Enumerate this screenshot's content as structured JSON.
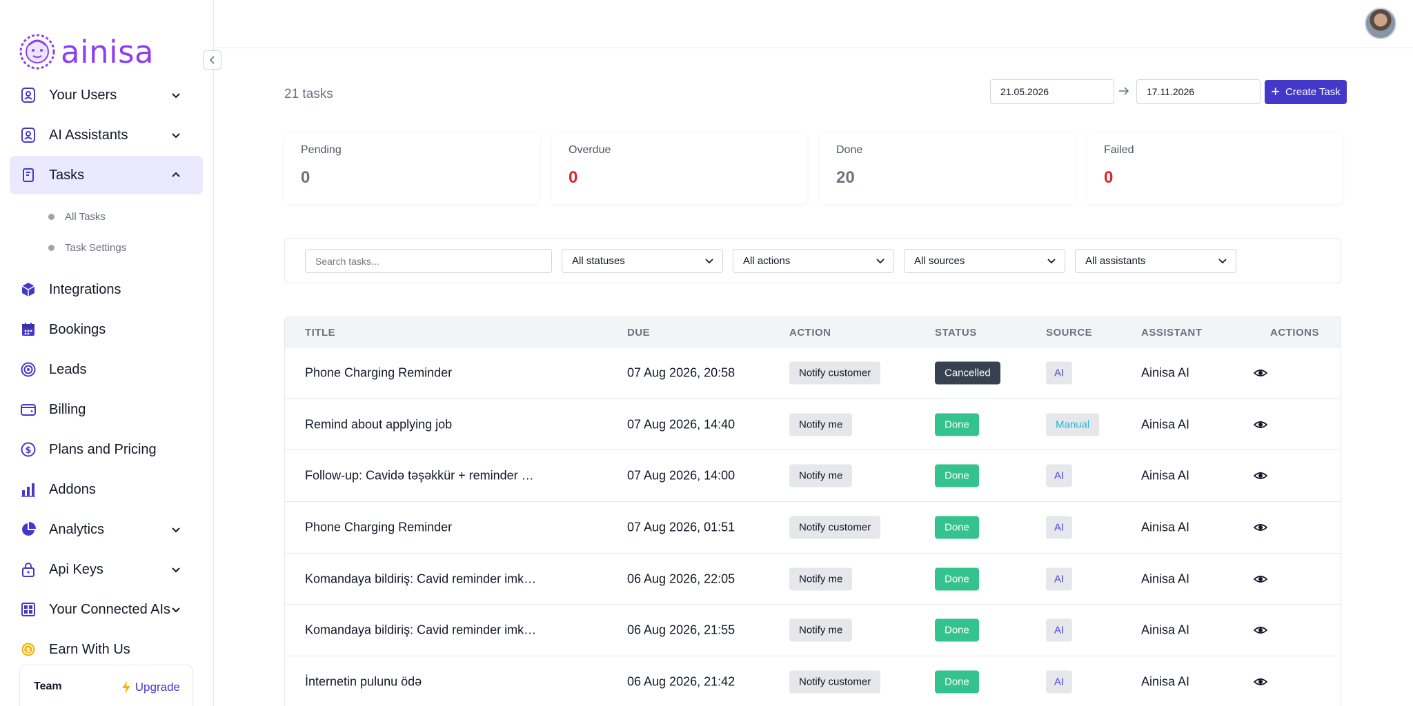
{
  "brand": {
    "name": "ainisa",
    "color": "#8b3ff0",
    "accent": "#4338ca"
  },
  "sidebar": {
    "items": [
      {
        "label": "Your Users",
        "icon": "user-badge-icon",
        "expandable": true,
        "expanded": false
      },
      {
        "label": "AI Assistants",
        "icon": "user-badge-icon",
        "expandable": true,
        "expanded": false
      },
      {
        "label": "Tasks",
        "icon": "clipboard-icon",
        "expandable": true,
        "expanded": true,
        "active": true,
        "children": [
          {
            "label": "All Tasks"
          },
          {
            "label": "Task Settings"
          }
        ]
      },
      {
        "label": "Integrations",
        "icon": "cube-icon"
      },
      {
        "label": "Bookings",
        "icon": "calendar-icon"
      },
      {
        "label": "Leads",
        "icon": "target-icon"
      },
      {
        "label": "Billing",
        "icon": "wallet-icon"
      },
      {
        "label": "Plans and Pricing",
        "icon": "dollar-circle-icon"
      },
      {
        "label": "Addons",
        "icon": "bar-chart-icon"
      },
      {
        "label": "Analytics",
        "icon": "pie-chart-icon",
        "expandable": true
      },
      {
        "label": "Api Keys",
        "icon": "lock-icon",
        "expandable": true
      },
      {
        "label": "Your Connected AIs",
        "icon": "grid-icon",
        "expandable": true
      },
      {
        "label": "Earn With Us",
        "icon": "coin-icon"
      }
    ],
    "team": {
      "label": "Team",
      "upgrade_label": "Upgrade"
    }
  },
  "main": {
    "task_count": "21 tasks",
    "date_from": "21.05.2026",
    "date_to": "17.11.2026",
    "create_label": "Create Task",
    "stats": [
      {
        "label": "Pending",
        "value": "0",
        "color": "#6b7280"
      },
      {
        "label": "Overdue",
        "value": "0",
        "color": "#dc2626"
      },
      {
        "label": "Done",
        "value": "20",
        "color": "#6b7280"
      },
      {
        "label": "Failed",
        "value": "0",
        "color": "#dc2626"
      }
    ],
    "filters": {
      "search_placeholder": "Search tasks...",
      "statuses": "All statuses",
      "actions": "All actions",
      "sources": "All sources",
      "assistants": "All assistants"
    },
    "table": {
      "headers": [
        "TITLE",
        "DUE",
        "ACTION",
        "STATUS",
        "SOURCE",
        "ASSISTANT",
        "ACTIONS"
      ],
      "rows": [
        {
          "title": "Phone Charging Reminder",
          "due": "07 Aug 2026, 20:58",
          "action": "Notify customer",
          "status": "Cancelled",
          "source": "AI",
          "assistant": "Ainisa AI"
        },
        {
          "title": "Remind about applying job",
          "due": "07 Aug 2026, 14:40",
          "action": "Notify me",
          "status": "Done",
          "source": "Manual",
          "assistant": "Ainisa AI"
        },
        {
          "title": "Follow-up: Cavidə təşəkkür + reminder …",
          "due": "07 Aug 2026, 14:00",
          "action": "Notify me",
          "status": "Done",
          "source": "AI",
          "assistant": "Ainisa AI"
        },
        {
          "title": "Phone Charging Reminder",
          "due": "07 Aug 2026, 01:51",
          "action": "Notify customer",
          "status": "Done",
          "source": "AI",
          "assistant": "Ainisa AI"
        },
        {
          "title": "Komandaya bildiriş: Cavid reminder imk…",
          "due": "06 Aug 2026, 22:05",
          "action": "Notify me",
          "status": "Done",
          "source": "AI",
          "assistant": "Ainisa AI"
        },
        {
          "title": "Komandaya bildiriş: Cavid reminder imk…",
          "due": "06 Aug 2026, 21:55",
          "action": "Notify me",
          "status": "Done",
          "source": "AI",
          "assistant": "Ainisa AI"
        },
        {
          "title": "İnternetin pulunu ödə",
          "due": "06 Aug 2026, 21:42",
          "action": "Notify customer",
          "status": "Done",
          "source": "AI",
          "assistant": "Ainisa AI"
        }
      ]
    }
  }
}
